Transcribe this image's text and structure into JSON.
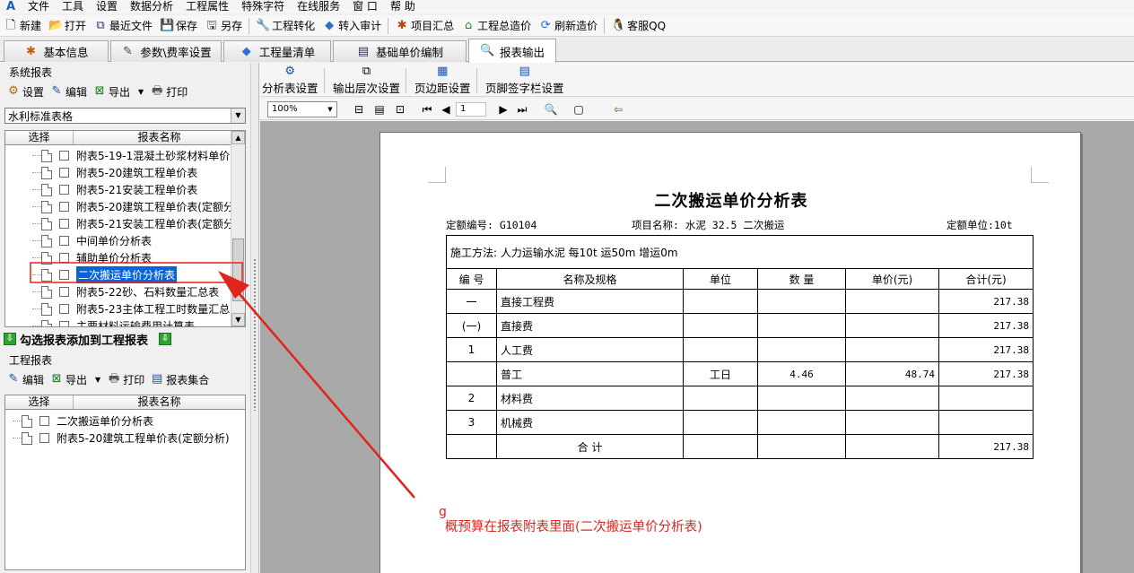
{
  "menu": {
    "items": [
      "文件",
      "工具",
      "设置",
      "数据分析",
      "工程属性",
      "特殊字符",
      "在线服务",
      "窗 口",
      "帮 助"
    ]
  },
  "toolbar": {
    "new": "新建",
    "open": "打开",
    "recent": "最近文件",
    "save": "保存",
    "save_as": "另存",
    "convert": "工程转化",
    "import_audit": "转入审计",
    "summary": "项目汇总",
    "total_cost": "工程总造价",
    "refresh": "刷新造价",
    "qq": "客服QQ"
  },
  "tabs": [
    "基本信息",
    "参数\\费率设置",
    "工程量清单",
    "基础单价编制",
    "报表输出"
  ],
  "system_reports": {
    "title": "系统报表",
    "toolbar": {
      "settings": "设置",
      "edit": "编辑",
      "export": "导出",
      "print": "打印"
    },
    "combo_value": "水利标准表格",
    "columns": {
      "select": "选择",
      "name": "报表名称"
    },
    "items": [
      {
        "label": "附表5-19-1混凝土砂浆材料单价"
      },
      {
        "label": "附表5-20建筑工程单价表"
      },
      {
        "label": "附表5-21安装工程单价表"
      },
      {
        "label": "附表5-20建筑工程单价表(定额分"
      },
      {
        "label": "附表5-21安装工程单价表(定额分"
      },
      {
        "label": "中间单价分析表"
      },
      {
        "label": "辅助单价分析表"
      },
      {
        "label": "二次搬运单价分析表"
      },
      {
        "label": "附表5-22砂、石料数量汇总表"
      },
      {
        "label": "附表5-23主体工程工时数量汇总"
      },
      {
        "label": "主要材料运输费用计算表"
      }
    ],
    "selected_index": 7
  },
  "add_to_project": "勾选报表添加到工程报表",
  "project_reports": {
    "title": "工程报表",
    "toolbar": {
      "edit": "编辑",
      "export": "导出",
      "print": "打印",
      "collection": "报表集合"
    },
    "columns": {
      "select": "选择",
      "name": "报表名称"
    },
    "items": [
      {
        "label": "二次搬运单价分析表"
      },
      {
        "label": "附表5-20建筑工程单价表(定额分析)"
      }
    ]
  },
  "report_toolbar": {
    "analysis_settings": "分析表设置",
    "output_level": "输出层次设置",
    "margin": "页边距设置",
    "footer_sign": "页脚签字栏设置"
  },
  "preview_toolbar": {
    "zoom": "100%",
    "page": "1"
  },
  "report": {
    "title": "二次搬运单价分析表",
    "quota_no": "定额编号: G10104",
    "project_name": "项目名称: 水泥 32.5  二次搬运",
    "quota_unit": "定额单位:10t",
    "method": "施工方法: 人力运输水泥 每10t 运50m 增运0m",
    "headers": [
      "编 号",
      "名称及规格",
      "单位",
      "数  量",
      "单价(元)",
      "合计(元)"
    ],
    "rows": [
      {
        "no": "一",
        "name": "直接工程费",
        "unit": "",
        "qty": "",
        "price": "",
        "total": "217.38"
      },
      {
        "no": "(一)",
        "name": "直接费",
        "unit": "",
        "qty": "",
        "price": "",
        "total": "217.38"
      },
      {
        "no": "1",
        "name": "人工费",
        "unit": "",
        "qty": "",
        "price": "",
        "total": "217.38"
      },
      {
        "no": "",
        "name": "普工",
        "unit": "工日",
        "qty": "4.46",
        "price": "48.74",
        "total": "217.38"
      },
      {
        "no": "2",
        "name": "材料费",
        "unit": "",
        "qty": "",
        "price": "",
        "total": ""
      },
      {
        "no": "3",
        "name": "机械费",
        "unit": "",
        "qty": "",
        "price": "",
        "total": ""
      }
    ],
    "sum_label": "合 计",
    "sum_total": "217.38"
  },
  "annotation": {
    "g": "g",
    "text": "概预算在报表附表里面(二次搬运单价分析表)",
    "color": "#e0241c"
  }
}
